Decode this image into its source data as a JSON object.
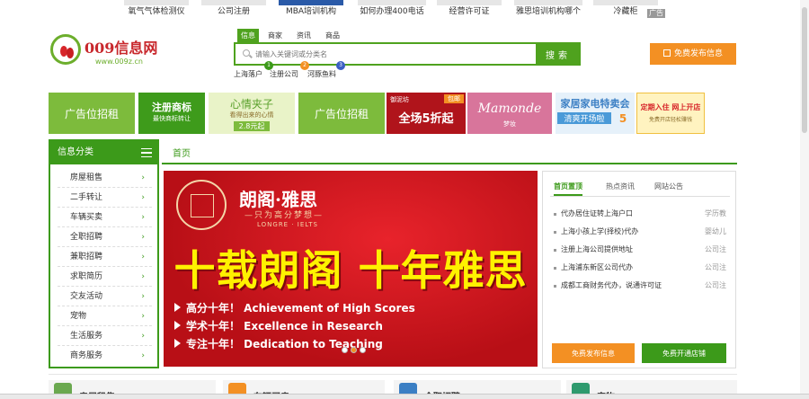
{
  "top_ads": {
    "items": [
      "氧气气体检测仪",
      "公司注册",
      "MBA培训机构",
      "如何办理400电话",
      "经营许可证",
      "雅思培训机构哪个",
      "冷藏柜"
    ],
    "tag": "广告"
  },
  "logo": {
    "name": "009信息网",
    "url": "www.009z.cn"
  },
  "search": {
    "tabs": [
      "信息",
      "商家",
      "资讯",
      "商品"
    ],
    "placeholder": "请输入关键词或分类名",
    "button": "搜索",
    "hot": [
      {
        "badge": "1",
        "text": "上海落户"
      },
      {
        "badge": "2",
        "text": "注册公司"
      },
      {
        "badge": "3",
        "text": "河豚鱼料"
      }
    ]
  },
  "header": {
    "publish_button": "免费发布信息"
  },
  "banners": [
    {
      "text": "广告位招租",
      "color": "#7dbb3c"
    },
    {
      "text": "注册商标",
      "sub": "最快商标转让",
      "color": "#3e9b1b"
    },
    {
      "text": "心情夹子",
      "sub": "看得出来的心情",
      "price": "2.8元起",
      "color": "#e9f3c8"
    },
    {
      "text": "广告位招租",
      "color": "#7dbb3c"
    },
    {
      "text": "全场5折起",
      "brand": "御泥坊",
      "tag": "包邮",
      "color": "#b0141b"
    },
    {
      "text": "Mamonde",
      "sub": "梦妆",
      "color": "#d8759b"
    },
    {
      "text": "家居家电特卖会",
      "sub": "清爽开场啦",
      "num": "5",
      "color": "#4a9ad8"
    },
    {
      "text": "定期入住 网上开店",
      "sub": "免费开店轻松赚钱",
      "color": "#fff3c0"
    }
  ],
  "sidebar": {
    "title": "信息分类",
    "items": [
      {
        "label": "房屋租售"
      },
      {
        "label": "二手转让"
      },
      {
        "label": "车辆买卖"
      },
      {
        "label": "全职招聘"
      },
      {
        "label": "兼职招聘"
      },
      {
        "label": "求职简历"
      },
      {
        "label": "交友活动"
      },
      {
        "label": "宠物"
      },
      {
        "label": "生活服务"
      },
      {
        "label": "商务服务"
      }
    ]
  },
  "nav": {
    "home": "首页"
  },
  "slider": {
    "brand": "朗阁·雅思",
    "sub": "—只为高分梦想—",
    "en": "LONGRE · IELTS",
    "headline": "十载朗阁 十年雅思",
    "lines": [
      "高分十年！ Achievement of High Scores",
      "学术十年！ Excellence in Research",
      "专注十年！ Dedication to Teaching"
    ],
    "current": 2,
    "total": 3
  },
  "news": {
    "tabs": [
      "首页置顶",
      "热点资讯",
      "网站公告"
    ],
    "items": [
      {
        "title": "代办居住证转上海户口",
        "cat": "学历教"
      },
      {
        "title": "上海小孩上学(择校)代办",
        "cat": "婴幼儿"
      },
      {
        "title": "注册上海公司提供地址",
        "cat": "公司注"
      },
      {
        "title": "上海浦东新区公司代办",
        "cat": "公司注"
      },
      {
        "title": "成都工商财务代办，说通许可证",
        "cat": "公司注"
      }
    ],
    "button_publish": "免费发布信息",
    "button_shop": "免费开通店铺"
  },
  "bottom": [
    {
      "label": "房屋租售",
      "color": "#6aa84f"
    },
    {
      "label": "车辆买卖",
      "color": "#f39023"
    },
    {
      "label": "全职招聘",
      "color": "#3b7fc4"
    },
    {
      "label": "宠物",
      "color": "#2e9a6e"
    }
  ],
  "colors": {
    "brand_green": "#3c9a1a",
    "accent_orange": "#f39023",
    "logo_red": "#c8272c"
  }
}
